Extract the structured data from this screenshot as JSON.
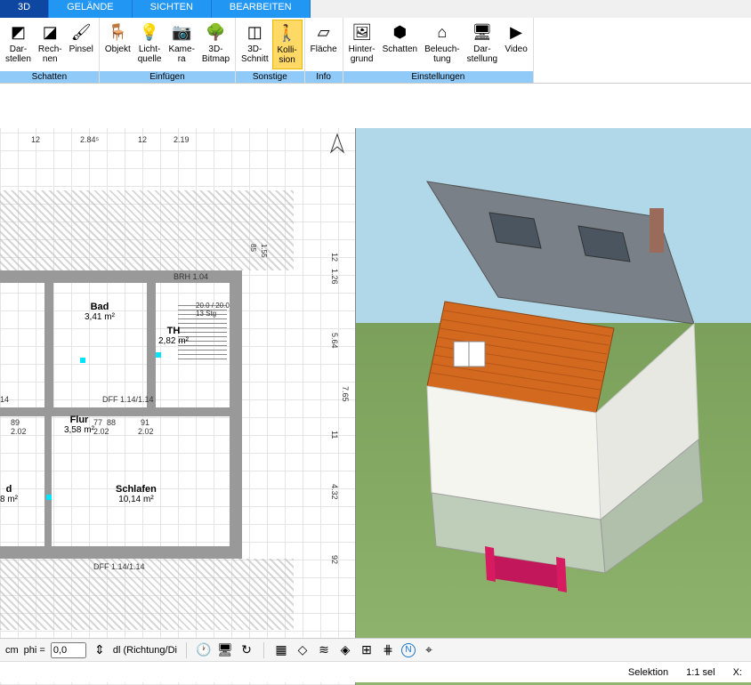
{
  "tabs": {
    "t1": "3D",
    "t2": "GELÄNDE",
    "t3": "SICHTEN",
    "t4": "BEARBEITEN"
  },
  "ribbon": {
    "schatten": {
      "label": "Schatten",
      "darstellen": "Dar-\nstellen",
      "rechnen": "Rech-\nnen",
      "pinsel": "Pinsel"
    },
    "einfuegen": {
      "label": "Einfügen",
      "objekt": "Objekt",
      "lichtquelle": "Licht-\nquelle",
      "kamera": "Kame-\nra",
      "bitmap": "3D-\nBitmap"
    },
    "sonstige": {
      "label": "Sonstige",
      "schnitt": "3D-\nSchnitt",
      "kollision": "Kolli-\nsion"
    },
    "info": {
      "label": "Info",
      "flaeche": "Fläche"
    },
    "einstellungen": {
      "label": "Einstellungen",
      "hintergrund": "Hinter-\ngrund",
      "schatten2": "Schatten",
      "beleuchtung": "Beleuch-\ntung",
      "darstellung": "Dar-\nstellung",
      "video": "Video"
    }
  },
  "plan": {
    "rooms": {
      "bad": {
        "name": "Bad",
        "area": "3,41 m²"
      },
      "th": {
        "name": "TH",
        "area": "2,82 m²"
      },
      "flur": {
        "name": "Flur",
        "area": "3,58 m²"
      },
      "schlafen": {
        "name": "Schlafen",
        "area": "10,14 m²"
      },
      "d": {
        "name": "d",
        "area": "8 m²"
      }
    },
    "dims": {
      "d1": "2.84⁵",
      "d2": "12",
      "d3": "2.19",
      "d4": "12",
      "d5": "1.26",
      "d6": "5.64",
      "d7": "7.65",
      "d8": "4.32",
      "d9": "92",
      "d10": "89",
      "d11": "2.02",
      "d12": "77",
      "d13": "88",
      "d14": "91",
      "d15": "14",
      "brh": "BRH 1.04",
      "dff1": "DFF 1.14/1.14",
      "dff2": "DFF 1.14/1.14",
      "stair": "20.0 / 20.0\n13 Stg",
      "r12": "12",
      "r85": "85",
      "r155": "1.55",
      "r11": "11",
      "r202": "2.02",
      "r202b": "2.02"
    }
  },
  "statusbar": {
    "cm": "cm",
    "phi_label": "phi =",
    "phi_value": "0,0",
    "dl": "dl (Richtung/Di"
  },
  "footer": {
    "selektion": "Selektion",
    "scale": "1:1 sel",
    "x": "X:"
  }
}
